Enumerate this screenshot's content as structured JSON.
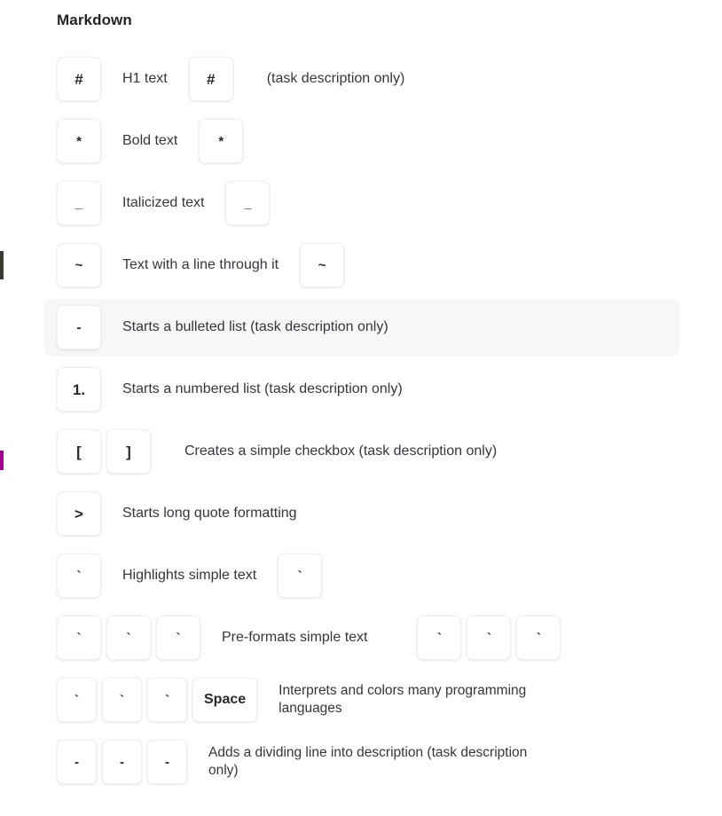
{
  "section": {
    "title": "Markdown"
  },
  "colors": {
    "page_background": "#ffffff",
    "text": "#33363c",
    "heading": "#232529",
    "key_background": "#ffffff",
    "key_border": "#f0f0f1",
    "row_highlight": "#f7f7f8",
    "edge_artifact_dark": "#3d3a33",
    "edge_artifact_pink": "#a3008f"
  },
  "rows": [
    {
      "id": "h1",
      "highlighted": false,
      "leading_keys": [
        "#"
      ],
      "label": "H1 text",
      "trailing_keys": [
        "#"
      ],
      "note": "(task description only)"
    },
    {
      "id": "bold",
      "highlighted": false,
      "leading_keys": [
        "*"
      ],
      "label": "Bold text",
      "trailing_keys": [
        "*"
      ],
      "note": ""
    },
    {
      "id": "italic",
      "highlighted": false,
      "leading_keys": [
        "_"
      ],
      "label": "Italicized text",
      "trailing_keys": [
        "_"
      ],
      "note": ""
    },
    {
      "id": "strikethrough",
      "highlighted": false,
      "leading_keys": [
        "~"
      ],
      "label": "Text with a line through it",
      "trailing_keys": [
        "~"
      ],
      "note": ""
    },
    {
      "id": "bulleted-list",
      "highlighted": true,
      "leading_keys": [
        "-"
      ],
      "label": "Starts a bulleted list (task description only)",
      "trailing_keys": [],
      "note": ""
    },
    {
      "id": "numbered-list",
      "highlighted": false,
      "leading_keys": [
        "1."
      ],
      "label": "Starts a numbered list (task description only)",
      "trailing_keys": [],
      "note": ""
    },
    {
      "id": "checkbox",
      "highlighted": false,
      "leading_keys": [
        "[",
        "]"
      ],
      "label": "Creates a simple checkbox (task description only)",
      "trailing_keys": [],
      "note": ""
    },
    {
      "id": "blockquote",
      "highlighted": false,
      "leading_keys": [
        ">"
      ],
      "label": "Starts long quote formatting",
      "trailing_keys": [],
      "note": ""
    },
    {
      "id": "inline-code",
      "highlighted": false,
      "leading_keys": [
        "`"
      ],
      "label": "Highlights simple text",
      "trailing_keys": [
        "`"
      ],
      "note": ""
    },
    {
      "id": "code-block",
      "highlighted": false,
      "leading_keys": [
        "`",
        "`",
        "`"
      ],
      "label": "Pre-formats simple text",
      "trailing_keys": [
        "`",
        "`",
        "`"
      ],
      "note": ""
    },
    {
      "id": "syntax-highlight",
      "highlighted": false,
      "leading_keys": [
        "`",
        "`",
        "`",
        "Space"
      ],
      "label": "Interprets and colors many programming\nlanguages",
      "trailing_keys": [],
      "note": ""
    },
    {
      "id": "divider",
      "highlighted": false,
      "leading_keys": [
        "-",
        "-",
        "-"
      ],
      "label": "Adds a dividing line into description (task description\nonly)",
      "trailing_keys": [],
      "note": ""
    }
  ]
}
